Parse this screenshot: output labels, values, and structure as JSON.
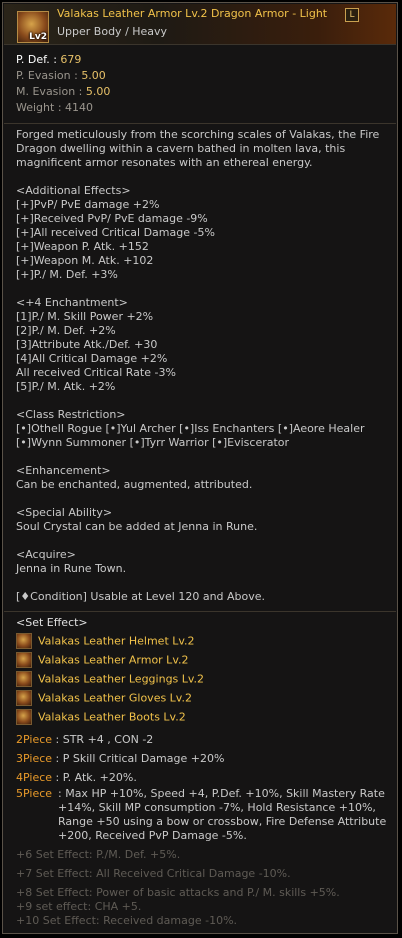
{
  "item": {
    "title": "Valakas Leather Armor Lv.2  Dragon Armor - Light",
    "subtitle": "Upper Body / Heavy",
    "icon": "leather-armor-icon",
    "badge": "Lv2",
    "grade": "L"
  },
  "stats": [
    {
      "label": "P. Def. : ",
      "value": "679"
    },
    {
      "label": "P. Evasion : ",
      "value": "5.00"
    },
    {
      "label": "M. Evasion : ",
      "value": "5.00"
    },
    {
      "label": "Weight : ",
      "value": "4140"
    }
  ],
  "description": {
    "intro": "Forged meticulously from the scorching scales of Valakas, the Fire Dragon dwelling within a cavern bathed in molten lava, this magnificent armor resonates with an ethereal energy.",
    "additional_header": "<Additional Effects>",
    "additional": [
      "[+]PvP/ PvE damage +2%",
      "[+]Received PvP/ PvE damage -9%",
      "[+]All received Critical Damage -5%",
      "[+]Weapon P. Atk. +152",
      "[+]Weapon M. Atk. +102",
      "[+]P./ M. Def. +3%"
    ],
    "enchant_header": "<+4 Enchantment>",
    "enchant": [
      "[1]P./ M. Skill Power +2%",
      "[2]P./ M. Def. +2%",
      "[3]Attribute Atk./Def. +30",
      "[4]All Critical Damage +2%",
      "All received Critical Rate -3%",
      "[5]P./ M. Atk. +2%"
    ],
    "class_header": "<Class Restriction>",
    "class": [
      "[•]Othell Rogue [•]Yul Archer [•]Iss Enchanters [•]Aeore Healer",
      "[•]Wynn Summoner [•]Tyrr Warrior [•]Eviscerator"
    ],
    "enh_header": "<Enhancement>",
    "enh": "Can be enchanted, augmented, attributed.",
    "special_header": "<Special Ability>",
    "special": "Soul Crystal can be added at Jenna in Rune.",
    "acquire_header": "<Acquire>",
    "acquire": "Jenna in Rune Town.",
    "condition": "[♦Condition] Usable at Level 120 and Above."
  },
  "set": {
    "header": "<Set Effect>",
    "items": [
      {
        "name": "Valakas Leather Helmet Lv.2",
        "icon": "helmet-icon"
      },
      {
        "name": "Valakas Leather Armor Lv.2",
        "icon": "armor-icon"
      },
      {
        "name": "Valakas Leather Leggings Lv.2",
        "icon": "leggings-icon"
      },
      {
        "name": "Valakas Leather Gloves Lv.2",
        "icon": "gloves-icon"
      },
      {
        "name": "Valakas Leather Boots Lv.2",
        "icon": "boots-icon"
      }
    ],
    "pieces": [
      {
        "count": "2Piece",
        "effect": " : STR +4 , CON -2"
      },
      {
        "count": "3Piece",
        "effect": " : P Skill Critical Damage +20%"
      },
      {
        "count": "4Piece",
        "effect": " : P. Atk. +20%."
      },
      {
        "count": "5Piece",
        "effect": " : Max HP +10%, Speed +4, P.Def. +10%, Skill Mastery Rate +14%, Skill MP consumption -7%, Hold Resistance +10%, Range +50 using a bow or crossbow, Fire Defense Attribute +200, Received PvP Damage -5%."
      }
    ],
    "extra": [
      "+6 Set Effect: P./M. Def. +5%.",
      "+7 Set Effect: All Received Critical Damage -10%.",
      "+8 Set Effect: Power of basic attacks and P./ M. skills +5%.",
      "+9 set effect: CHA +5.",
      "+10 Set Effect: Received damage -10%."
    ]
  },
  "colors": {
    "title": "#f1c24a",
    "value": "#e6c068",
    "piece": "#e89a2a",
    "inactive": "#5f5b55"
  }
}
